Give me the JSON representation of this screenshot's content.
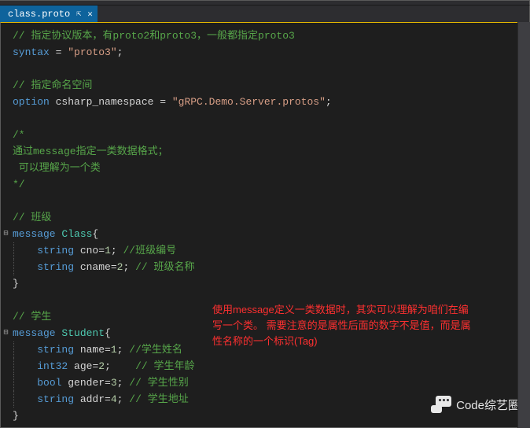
{
  "tab": {
    "filename": "class.proto",
    "pin": "⇱",
    "close": "✕"
  },
  "code": {
    "l1_cm": "// 指定协议版本，有proto2和proto3，一般都指定proto3",
    "l2_kw": "syntax",
    "l2_eq": " = ",
    "l2_str": "\"proto3\"",
    "l2_semi": ";",
    "l4_cm": "// 指定命名空间",
    "l5_kw": "option",
    "l5_id": " csharp_namespace",
    "l5_eq": " = ",
    "l5_str": "\"gRPC.Demo.Server.protos\"",
    "l5_semi": ";",
    "l7_cm": "/*",
    "l8_cm": "通过message指定一类数据格式；",
    "l9_cm": " 可以理解为一个类",
    "l10_cm": "*/",
    "l12_cm": "// 班级",
    "l13_kw": "message",
    "l13_ty": " Class",
    "l13_br": "{",
    "l14_pre": "    ",
    "l14_ty": "string",
    "l14_id": " cno",
    "l14_eq": "=",
    "l14_nm": "1",
    "l14_semi": ";",
    "l14_cm": " //班级编号",
    "l15_pre": "    ",
    "l15_ty": "string",
    "l15_id": " cname",
    "l15_eq": "=",
    "l15_nm": "2",
    "l15_semi": ";",
    "l15_cm": " // 班级名称",
    "l16_br": "}",
    "l18_cm": "// 学生",
    "l19_kw": "message",
    "l19_ty": " Student",
    "l19_br": "{",
    "l20_pre": "    ",
    "l20_ty": "string",
    "l20_id": " name",
    "l20_eq": "=",
    "l20_nm": "1",
    "l20_semi": ";",
    "l20_cm": " //学生姓名",
    "l21_pre": "    ",
    "l21_ty": "int32",
    "l21_id": " age",
    "l21_eq": "=",
    "l21_nm": "2",
    "l21_semi": ";",
    "l21_cm": "    // 学生年龄",
    "l22_pre": "    ",
    "l22_ty": "bool",
    "l22_id": " gender",
    "l22_eq": "=",
    "l22_nm": "3",
    "l22_semi": ";",
    "l22_cm": " // 学生性别",
    "l23_pre": "    ",
    "l23_ty": "string",
    "l23_id": " addr",
    "l23_eq": "=",
    "l23_nm": "4",
    "l23_semi": ";",
    "l23_cm": " // 学生地址",
    "l24_br": "}"
  },
  "annotation": {
    "l1": "使用message定义一类数据时，其实可以理解为咱们在编",
    "l2": "写一个类。 需要注意的是属性后面的数字不是值，而是属",
    "l3": "性名称的一个标识(Tag)"
  },
  "fold": {
    "minus": "⊟"
  },
  "watermark": {
    "text": "Code综艺圈"
  }
}
